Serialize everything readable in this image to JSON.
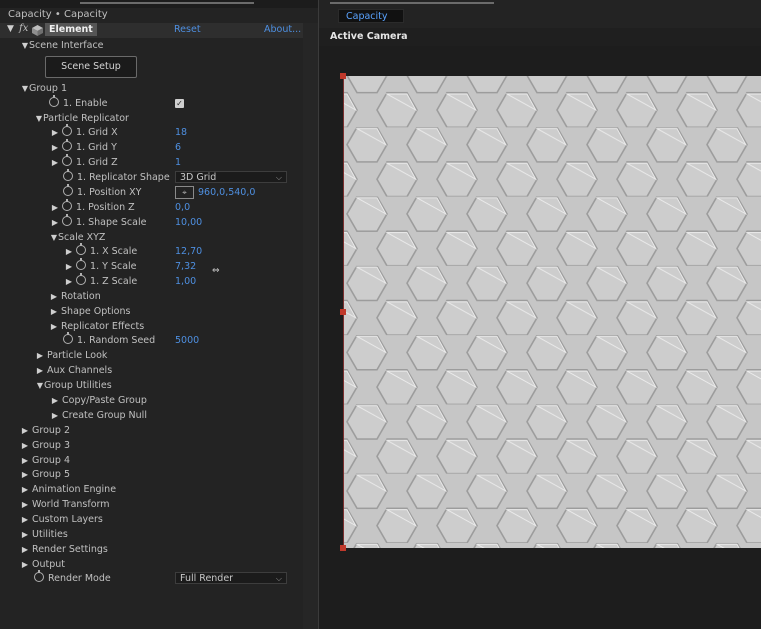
{
  "effect_panel": {
    "title": "Capacity • Capacity",
    "effect_name": "Element",
    "reset_label": "Reset",
    "about_label": "About...",
    "scene_setup_button": "Scene Setup",
    "rows": [
      {
        "label": "Scene Interface",
        "twirl": "▼"
      },
      {
        "label": "Group 1",
        "twirl": "▼"
      },
      {
        "label": "1. Enable",
        "value": ""
      },
      {
        "label": "Particle Replicator",
        "twirl": "▼"
      },
      {
        "label": "1. Grid X",
        "value": "18",
        "twirl": "▶"
      },
      {
        "label": "1. Grid Y",
        "value": "6",
        "twirl": "▶"
      },
      {
        "label": "1. Grid Z",
        "value": "1",
        "twirl": "▶"
      },
      {
        "label": "1. Replicator Shape",
        "value": "3D Grid"
      },
      {
        "label": "1. Position XY",
        "value": "960,0,540,0"
      },
      {
        "label": "1. Position Z",
        "value": "0,0",
        "twirl": "▶"
      },
      {
        "label": "1. Shape Scale",
        "value": "10,00",
        "twirl": "▶"
      },
      {
        "label": "Scale XYZ",
        "twirl": "▼"
      },
      {
        "label": "1. X Scale",
        "value": "12,70",
        "twirl": "▶"
      },
      {
        "label": "1. Y Scale",
        "value": "7,32",
        "twirl": "▶"
      },
      {
        "label": "1. Z Scale",
        "value": "1,00",
        "twirl": "▶"
      },
      {
        "label": "Rotation",
        "twirl": "▶"
      },
      {
        "label": "Shape Options",
        "twirl": "▶"
      },
      {
        "label": "Replicator Effects",
        "twirl": "▶"
      },
      {
        "label": "1. Random Seed",
        "value": "5000"
      },
      {
        "label": "Particle Look",
        "twirl": "▶"
      },
      {
        "label": "Aux Channels",
        "twirl": "▶"
      },
      {
        "label": "Group Utilities",
        "twirl": "▼"
      },
      {
        "label": "Copy/Paste Group",
        "twirl": "▶"
      },
      {
        "label": "Create Group Null",
        "twirl": "▶"
      },
      {
        "label": "Group 2",
        "twirl": "▶"
      },
      {
        "label": "Group 3",
        "twirl": "▶"
      },
      {
        "label": "Group 4",
        "twirl": "▶"
      },
      {
        "label": "Group 5",
        "twirl": "▶"
      },
      {
        "label": "Animation Engine",
        "twirl": "▶"
      },
      {
        "label": "World Transform",
        "twirl": "▶"
      },
      {
        "label": "Custom Layers",
        "twirl": "▶"
      },
      {
        "label": "Utilities",
        "twirl": "▶"
      },
      {
        "label": "Render Settings",
        "twirl": "▶"
      },
      {
        "label": "Output",
        "twirl": "▶"
      },
      {
        "label": "Render Mode",
        "value": "Full Render"
      }
    ]
  },
  "viewer": {
    "comp_tab": "Capacity",
    "camera_label": "Active Camera",
    "surface_color": "#c9c9c9"
  },
  "colors": {
    "value_blue": "#4e8fe0",
    "tab_blue": "#5aa3ff",
    "handle_red": "#c0392b"
  }
}
